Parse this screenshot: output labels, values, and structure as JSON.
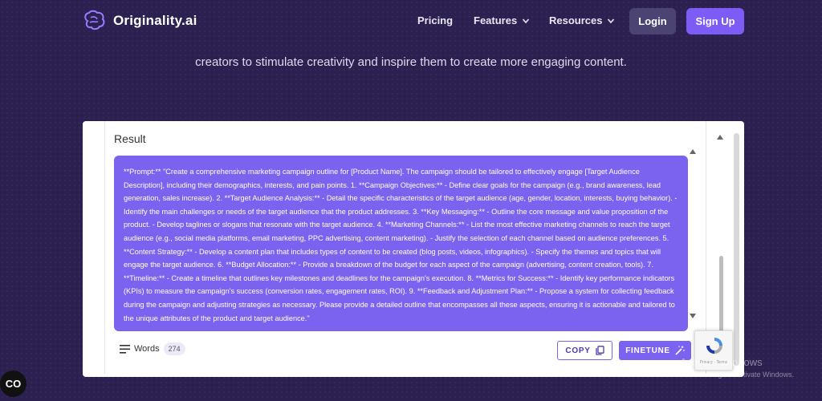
{
  "brand": {
    "name": "Originality.ai"
  },
  "nav": {
    "pricing": "Pricing",
    "features": "Features",
    "resources": "Resources",
    "login": "Login",
    "signup": "Sign Up"
  },
  "hero": {
    "line": "creators to stimulate creativity and inspire them to create more engaging content."
  },
  "result": {
    "title": "Result",
    "text": "**Prompt:** \"Create a comprehensive marketing campaign outline for [Product Name]. The campaign should be tailored to effectively engage [Target Audience Description], including their demographics, interests, and pain points.   1. **Campaign Objectives:**    - Define clear goals for the campaign (e.g., brand awareness, lead generation, sales increase).  2. **Target Audience Analysis:**    - Detail the specific characteristics of the target audience (age, gender, location, interests, buying behavior).    - Identify the main challenges or needs of the target audience that the product addresses.  3. **Key Messaging:**    - Outline the core message and value proposition of the product.    - Develop taglines or slogans that resonate with the target audience.  4. **Marketing Channels:**    - List the most effective marketing channels to reach the target audience (e.g., social media platforms, email marketing, PPC advertising, content marketing).    - Justify the selection of each channel based on audience preferences.  5. **Content Strategy:**    - Develop a content plan that includes types of content to be created (blog posts, videos, infographics).    - Specify the themes and topics that will engage the target audience.  6. **Budget Allocation:**    - Provide a breakdown of the budget for each aspect of the campaign (advertising, content creation, tools).  7. **Timeline:**    - Create a timeline that outlines key milestones and deadlines for the campaign's execution.  8. **Metrics for Success:**    - Identify key performance indicators (KPIs) to measure the campaign's success (conversion rates, engagement rates, ROI).  9. **Feedback and Adjustment Plan:**    - Propose a system for collecting feedback during the campaign and adjusting strategies as necessary.  Please provide a detailed outline that encompasses all these aspects, ensuring it is actionable and tailored to the unique attributes of the product and target audience.\"",
    "words_label": "Words",
    "word_count": "274",
    "copy_label": "COPY",
    "finetune_label": "FINETUNE"
  },
  "recaptcha": {
    "footer": "Privacy - Terms"
  },
  "windows": {
    "title": "Activate Windows",
    "sub": "Go to Settings to activate Windows."
  },
  "chat": {
    "label": "CO"
  },
  "colors": {
    "background": "#2b2050",
    "accent": "#7b63ef",
    "signup": "#7c5cf5",
    "login": "#4b4372"
  }
}
